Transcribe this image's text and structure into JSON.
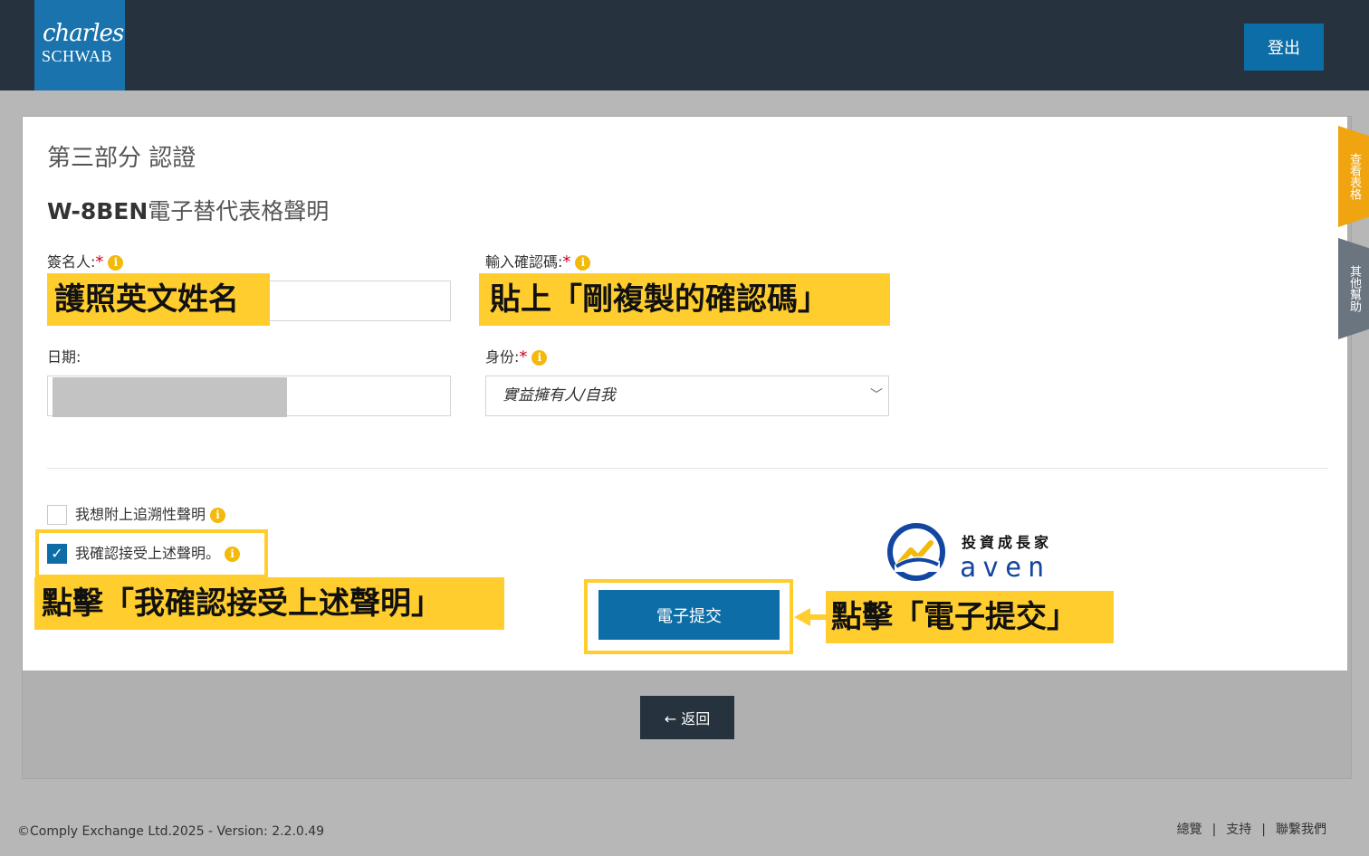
{
  "header": {
    "logo_line1": "charles",
    "logo_line2": "SCHWAB",
    "logout_label": "登出"
  },
  "side_tabs": [
    "查看表格",
    "其他幫助"
  ],
  "form": {
    "section_title": "第三部分 認證",
    "title_bold": "W-8BEN",
    "title_rest": "電子替代表格聲明",
    "signer_label": "簽名人:",
    "confirm_code_label": "輸入確認碼:",
    "date_label": "日期:",
    "identity_label": "身份:",
    "identity_value": "實益擁有人/自我",
    "required_mark": "*",
    "info_glyph": "i",
    "retro_checkbox_label": "我想附上追溯性聲明",
    "retro_checked": false,
    "accept_checkbox_label": "我確認接受上述聲明。",
    "accept_checked": true,
    "submit_label": "電子提交",
    "back_label": "返回"
  },
  "annotations": {
    "signer": "護照英文姓名",
    "confirm_code": "貼上「剛複製的確認碼」",
    "accept": "點擊「我確認接受上述聲明」",
    "submit": "點擊「電子提交」"
  },
  "watermark": {
    "top": "投資成長家",
    "bottom": "aven"
  },
  "footer": {
    "copyright": "©Comply Exchange Ltd.2025 - Version: 2.2.0.49",
    "links": [
      "總覽",
      "支持",
      "聯繫我們"
    ]
  },
  "colors": {
    "header_bg": "#26323d",
    "brand_blue": "#0d6ea7",
    "highlight_yellow": "#ffcd2e",
    "required_red": "#d0021b",
    "info_yellow": "#f3b90b"
  }
}
